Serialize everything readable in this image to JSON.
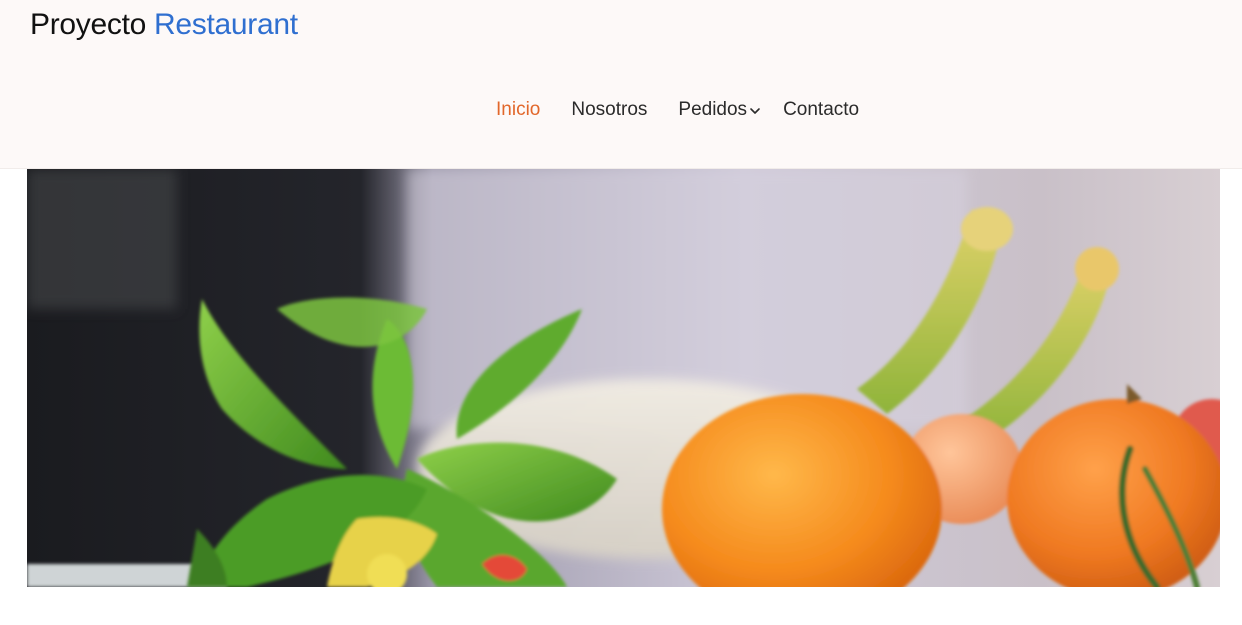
{
  "brand": {
    "name_part1": "Proyecto",
    "name_part2": "Restaurant"
  },
  "nav": {
    "items": [
      {
        "label": "Inicio",
        "active": true
      },
      {
        "label": "Nosotros",
        "active": false
      },
      {
        "label": "Pedidos",
        "active": false,
        "dropdown": true
      },
      {
        "label": "Contacto",
        "active": false
      }
    ]
  },
  "icons": {
    "dropdown": "chevron-down-icon"
  },
  "colors": {
    "accent_brand": "#2f6fd0",
    "active_nav": "#e2672a",
    "header_bg": "#fdf9f8",
    "text": "#2b2b2b"
  },
  "hero": {
    "image": "vegetables-hero-photo"
  }
}
